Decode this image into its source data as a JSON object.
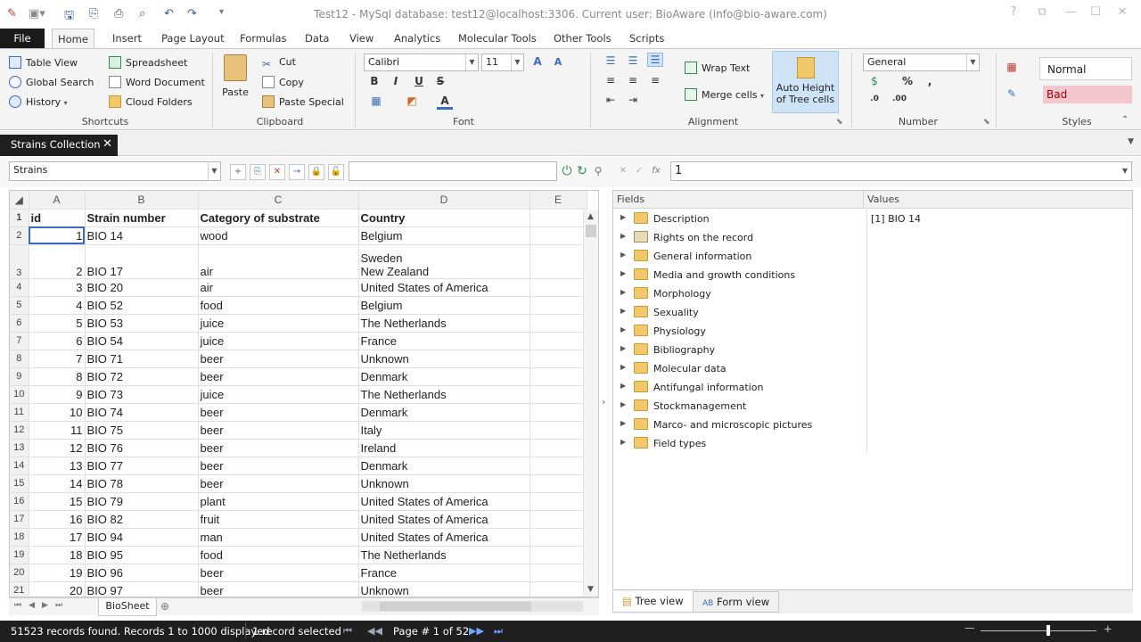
{
  "window": {
    "title": "Test12 - MySql database: test12@localhost:3306. Current user: BioAware (info@bio-aware.com)"
  },
  "ribbon_tabs": [
    "File",
    "Home",
    "Insert",
    "Page Layout",
    "Formulas",
    "Data",
    "View",
    "Analytics",
    "Molecular Tools",
    "Other Tools",
    "Scripts"
  ],
  "shortcuts": {
    "table_view": "Table View",
    "global_search": "Global Search",
    "history": "History",
    "spreadsheet": "Spreadsheet",
    "word_document": "Word Document",
    "cloud_folders": "Cloud Folders",
    "group": "Shortcuts"
  },
  "clipboard": {
    "paste": "Paste",
    "cut": "Cut",
    "copy": "Copy",
    "paste_special": "Paste Special",
    "group": "Clipboard"
  },
  "font": {
    "family": "Calibri",
    "size": "11",
    "group": "Font"
  },
  "alignment": {
    "wrap_text": "Wrap Text",
    "merge_cells": "Merge cells",
    "auto_height_1": "Auto Height",
    "auto_height_2": "of Tree cells",
    "group": "Alignment"
  },
  "number": {
    "format": "General",
    "group": "Number"
  },
  "styles": {
    "normal": "Normal",
    "bad": "Bad",
    "group": "Styles"
  },
  "document": {
    "tab": "Strains Collection"
  },
  "toolbar": {
    "table_select": "Strains",
    "formula_value": "1"
  },
  "sheet": {
    "columns": [
      "A",
      "B",
      "C",
      "D",
      "E"
    ],
    "header": [
      "id",
      "Strain number",
      "Category of substrate",
      "Country"
    ],
    "rows": [
      {
        "n": "2",
        "id": "1",
        "strain": "BIO 14",
        "cat": "wood",
        "country": "Belgium"
      },
      {
        "n": "3",
        "id": "2",
        "strain": "BIO 17",
        "cat": "air",
        "country": "New Zealand",
        "country_top": "Sweden"
      },
      {
        "n": "4",
        "id": "3",
        "strain": "BIO 20",
        "cat": "air",
        "country": "United States of America"
      },
      {
        "n": "5",
        "id": "4",
        "strain": "BIO 52",
        "cat": "food",
        "country": "Belgium"
      },
      {
        "n": "6",
        "id": "5",
        "strain": "BIO 53",
        "cat": "juice",
        "country": "The Netherlands"
      },
      {
        "n": "7",
        "id": "6",
        "strain": "BIO 54",
        "cat": "juice",
        "country": "France"
      },
      {
        "n": "8",
        "id": "7",
        "strain": "BIO 71",
        "cat": "beer",
        "country": "Unknown"
      },
      {
        "n": "9",
        "id": "8",
        "strain": "BIO 72",
        "cat": "beer",
        "country": "Denmark"
      },
      {
        "n": "10",
        "id": "9",
        "strain": "BIO 73",
        "cat": "juice",
        "country": "The Netherlands"
      },
      {
        "n": "11",
        "id": "10",
        "strain": "BIO 74",
        "cat": "beer",
        "country": "Denmark"
      },
      {
        "n": "12",
        "id": "11",
        "strain": "BIO 75",
        "cat": "beer",
        "country": "Italy"
      },
      {
        "n": "13",
        "id": "12",
        "strain": "BIO 76",
        "cat": "beer",
        "country": "Ireland"
      },
      {
        "n": "14",
        "id": "13",
        "strain": "BIO 77",
        "cat": "beer",
        "country": "Denmark"
      },
      {
        "n": "15",
        "id": "14",
        "strain": "BIO 78",
        "cat": "beer",
        "country": "Unknown"
      },
      {
        "n": "16",
        "id": "15",
        "strain": "BIO 79",
        "cat": "plant",
        "country": "United States of America"
      },
      {
        "n": "17",
        "id": "16",
        "strain": "BIO 82",
        "cat": "fruit",
        "country": "United States of America"
      },
      {
        "n": "18",
        "id": "17",
        "strain": "BIO 94",
        "cat": "man",
        "country": "United States of America"
      },
      {
        "n": "19",
        "id": "18",
        "strain": "BIO 95",
        "cat": "food",
        "country": "The Netherlands"
      },
      {
        "n": "20",
        "id": "19",
        "strain": "BIO 96",
        "cat": "beer",
        "country": "France"
      },
      {
        "n": "21",
        "id": "20",
        "strain": "BIO 97",
        "cat": "beer",
        "country": "Unknown"
      }
    ],
    "sheet_tab": "BioSheet"
  },
  "panel": {
    "fields_header": "Fields",
    "values_header": "Values",
    "rows": [
      {
        "label": "Description",
        "value": "[1] BIO 14"
      },
      {
        "label": "Rights on the record",
        "value": ""
      },
      {
        "label": "General information",
        "value": ""
      },
      {
        "label": "Media and growth conditions",
        "value": ""
      },
      {
        "label": "Morphology",
        "value": ""
      },
      {
        "label": "Sexuality",
        "value": ""
      },
      {
        "label": "Physiology",
        "value": ""
      },
      {
        "label": "Bibliography",
        "value": ""
      },
      {
        "label": "Molecular data",
        "value": ""
      },
      {
        "label": "Antifungal information",
        "value": ""
      },
      {
        "label": "Stockmanagement",
        "value": ""
      },
      {
        "label": "Marco- and microscopic pictures",
        "value": ""
      },
      {
        "label": "Field types",
        "value": ""
      }
    ],
    "tree_view": "Tree view",
    "form_view": "Form view"
  },
  "status": {
    "records": "51523 records found. Records 1 to 1000 displayed",
    "selected": "1 record selected",
    "page": "Page # 1 of 52"
  },
  "colors": {
    "accent": "#3a6cbf",
    "status_bar": "#1f1f1f",
    "folder": "#f2c96a",
    "bad_style": "#f4c7ce"
  }
}
